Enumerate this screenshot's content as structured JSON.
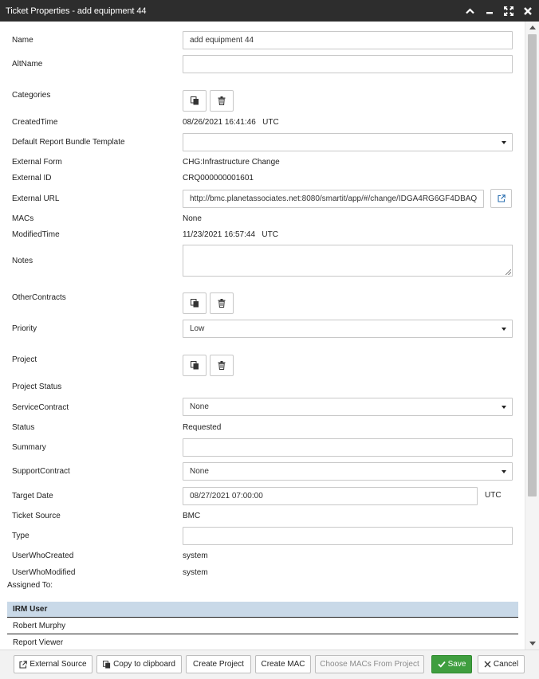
{
  "window": {
    "title": "Ticket Properties - add equipment 44"
  },
  "form": {
    "name": {
      "label": "Name",
      "value": "add equipment 44"
    },
    "altname": {
      "label": "AltName",
      "value": ""
    },
    "categories": {
      "label": "Categories"
    },
    "created_time": {
      "label": "CreatedTime",
      "value": "08/26/2021 16:41:46",
      "tz": "UTC"
    },
    "default_report_bundle": {
      "label": "Default Report Bundle Template",
      "value": ""
    },
    "external_form": {
      "label": "External Form",
      "value": "CHG:Infrastructure Change"
    },
    "external_id": {
      "label": "External ID",
      "value": "CRQ000000001601"
    },
    "external_url": {
      "label": "External URL",
      "value": "http://bmc.planetassociates.net:8080/smartit/app/#/change/IDGA4RG6GF4DBAQ"
    },
    "macs": {
      "label": "MACs",
      "value": "None"
    },
    "modified_time": {
      "label": "ModifiedTime",
      "value": "11/23/2021 16:57:44",
      "tz": "UTC"
    },
    "notes": {
      "label": "Notes",
      "value": ""
    },
    "other_contracts": {
      "label": "OtherContracts"
    },
    "priority": {
      "label": "Priority",
      "value": "Low"
    },
    "project": {
      "label": "Project"
    },
    "project_status": {
      "label": "Project Status"
    },
    "service_contract": {
      "label": "ServiceContract",
      "value": "None"
    },
    "status": {
      "label": "Status",
      "value": "Requested"
    },
    "summary": {
      "label": "Summary",
      "value": ""
    },
    "support_contract": {
      "label": "SupportContract",
      "value": "None"
    },
    "target_date": {
      "label": "Target Date",
      "value": "08/27/2021 07:00:00",
      "tz": "UTC"
    },
    "ticket_source": {
      "label": "Ticket Source",
      "value": "BMC"
    },
    "type": {
      "label": "Type",
      "value": ""
    },
    "user_who_created": {
      "label": "UserWhoCreated",
      "value": "system"
    },
    "user_who_modified": {
      "label": "UserWhoModified",
      "value": "system"
    }
  },
  "assigned": {
    "label": "Assigned To:",
    "header": "IRM User",
    "rows": [
      "Robert Murphy",
      "Report Viewer"
    ]
  },
  "footer": {
    "external_source": "External Source",
    "copy_clipboard": "Copy to clipboard",
    "create_project": "Create Project",
    "create_mac": "Create MAC",
    "choose_macs": "Choose MACs From Project",
    "save": "Save",
    "cancel": "Cancel"
  },
  "colors": {
    "titlebar": "#2d2d2d",
    "grid_header": "#c9d9e8",
    "save_button": "#3f9e3f"
  },
  "icons": [
    "chevron-up-icon",
    "minimize-icon",
    "fullscreen-icon",
    "close-icon",
    "copy-icon",
    "trash-icon",
    "external-link-icon",
    "check-icon",
    "x-icon"
  ]
}
